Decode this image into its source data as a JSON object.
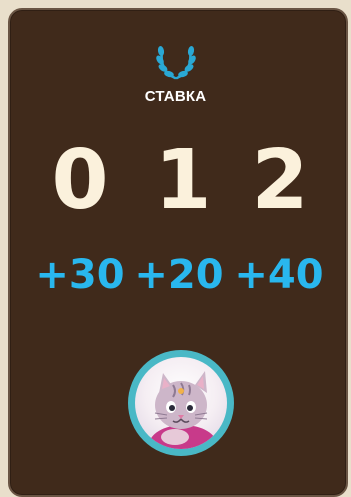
{
  "bet": {
    "label": "СТАВКА",
    "icon": "laurel-icon"
  },
  "scores": [
    "0",
    "1",
    "2"
  ],
  "bonuses": [
    "+30",
    "+20",
    "+40"
  ],
  "avatar": {
    "icon": "cat-character-avatar"
  },
  "colors": {
    "card_bg": "#402a1b",
    "score": "#fbf1dc",
    "bonus": "#29b7ee",
    "accent": "#2aa8d4",
    "avatar_ring": "#49b8c6"
  }
}
